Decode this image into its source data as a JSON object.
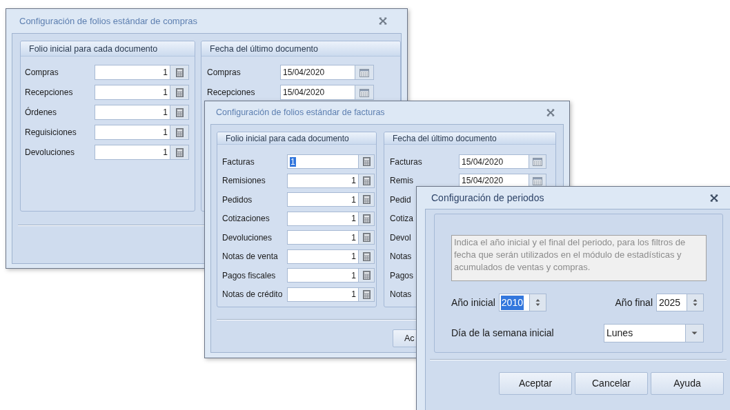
{
  "purchases_dialog": {
    "title": "Configuración de folios estándar de compras",
    "active": false,
    "groups": [
      {
        "heading": "Folio inicial para cada documento",
        "rows": [
          {
            "label": "Compras",
            "value": "1",
            "kind": "number"
          },
          {
            "label": "Recepciones",
            "value": "1",
            "kind": "number"
          },
          {
            "label": "Órdenes",
            "value": "1",
            "kind": "number"
          },
          {
            "label": "Reguisiciones",
            "value": "1",
            "kind": "number"
          },
          {
            "label": "Devoluciones",
            "value": "1",
            "kind": "number"
          }
        ]
      },
      {
        "heading": "Fecha del último documento",
        "rows": [
          {
            "label": "Compras",
            "value": "15/04/2020",
            "kind": "date"
          },
          {
            "label": "Recepciones",
            "value": "15/04/2020",
            "kind": "date"
          }
        ]
      }
    ]
  },
  "invoices_dialog": {
    "title": "Configuración de folios estándar de facturas",
    "active": false,
    "groups": [
      {
        "heading": "Folio inicial para cada documento",
        "rows": [
          {
            "label": "Facturas",
            "value": "1",
            "kind": "number",
            "focused": true
          },
          {
            "label": "Remisiones",
            "value": "1",
            "kind": "number",
            "focused": false
          },
          {
            "label": "Pedidos",
            "value": "1",
            "kind": "number",
            "focused": false
          },
          {
            "label": "Cotizaciones",
            "value": "1",
            "kind": "number",
            "focused": false
          },
          {
            "label": "Devoluciones",
            "value": "1",
            "kind": "number",
            "focused": false
          },
          {
            "label": "Notas de venta",
            "value": "1",
            "kind": "number",
            "focused": false
          },
          {
            "label": "Pagos fiscales",
            "value": "1",
            "kind": "number",
            "focused": false
          },
          {
            "label": "Notas de crédito",
            "value": "1",
            "kind": "number",
            "focused": false
          }
        ]
      },
      {
        "heading": "Fecha del último documento",
        "rows": [
          {
            "label": "Facturas",
            "value": "15/04/2020",
            "kind": "date"
          },
          {
            "label": "Remis",
            "value": "15/04/2020",
            "kind": "date"
          },
          {
            "label": "Pedid",
            "kind": "label"
          },
          {
            "label": "Cotiza",
            "kind": "label"
          },
          {
            "label": "Devol",
            "kind": "label"
          },
          {
            "label": "Notas",
            "kind": "label"
          },
          {
            "label": "Pagos",
            "kind": "label"
          },
          {
            "label": "Notas",
            "kind": "label"
          }
        ]
      }
    ],
    "buttons": [
      "Ac"
    ]
  },
  "periods_dialog": {
    "title": "Configuración de periodos",
    "active": true,
    "description": "Indica el año inicial y el final del periodo, para los filtros de fecha que serán utilizados en el módulo de estadísticas y acumulados de ventas y compras.",
    "year_fields": [
      {
        "label": "Año inicial",
        "value": "2010",
        "focused": true
      },
      {
        "label": "Año final",
        "value": "2025",
        "focused": false
      }
    ],
    "start_day": {
      "label": "Día de la semana inicial",
      "value": "Lunes"
    },
    "buttons": [
      "Aceptar",
      "Cancelar",
      "Ayuda"
    ]
  }
}
